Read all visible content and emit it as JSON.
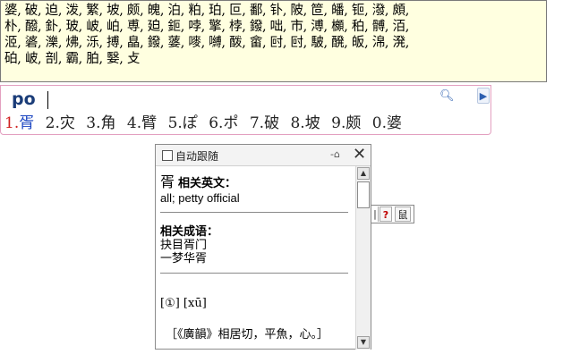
{
  "candidate_box": {
    "lines": [
      "婆, 破, 迫, 泼, 繁, 坡, 颇, 魄, 泊, 粕, 珀, 叵, 鄱, 钋, 陂, 笸, 皤, 钷, 潑, 頗,",
      "朴, 醱, 釙, 玻, 岥, 岶, 尃, 廹, 鉕, 哱, 擎, 桲, 鏺, 咄, 市, 溥, 櫇, 䄸, 髆, 洦,",
      "洍, 碆, 濼, 炥, 泺, 搏, 皛, 鏺, 蔢, 嘜, 嚩, 酦, 畲, 尀, 尀, 駊, 醗, 皈, 淿, 溌,",
      "砶, 岥, 剖, 霸, 胉, 嫛, 攴"
    ]
  },
  "ime": {
    "pinyin": "po",
    "candidates": [
      {
        "num": "1.",
        "char": "胥"
      },
      {
        "num": "2.",
        "char": "灾"
      },
      {
        "num": "3.",
        "char": "角"
      },
      {
        "num": "4.",
        "char": "臂"
      },
      {
        "num": "5.",
        "char": "ぽ"
      },
      {
        "num": "6.",
        "char": "ポ"
      },
      {
        "num": "7.",
        "char": "破"
      },
      {
        "num": "8.",
        "char": "坡"
      },
      {
        "num": "9.",
        "char": "颇"
      },
      {
        "num": "0.",
        "char": "婆"
      }
    ],
    "search_icon": "search-icon",
    "next_icon": "next-page-icon"
  },
  "panel": {
    "auto_follow_label": "自动跟随",
    "pin_icon": "pin-icon",
    "close_icon": "close-icon",
    "head_char": "胥",
    "english_head": "相关英文：",
    "english_text": "all; petty official",
    "idiom_head": "相关成语：",
    "idioms": [
      "抉目胥门",
      "一梦华胥"
    ],
    "pronunciation": "[①] [xū]",
    "definition": "［《廣韻》相居切，平魚，心。］"
  },
  "side_tools": {
    "t1": "|",
    "t2": "?",
    "t3": "鼠"
  }
}
